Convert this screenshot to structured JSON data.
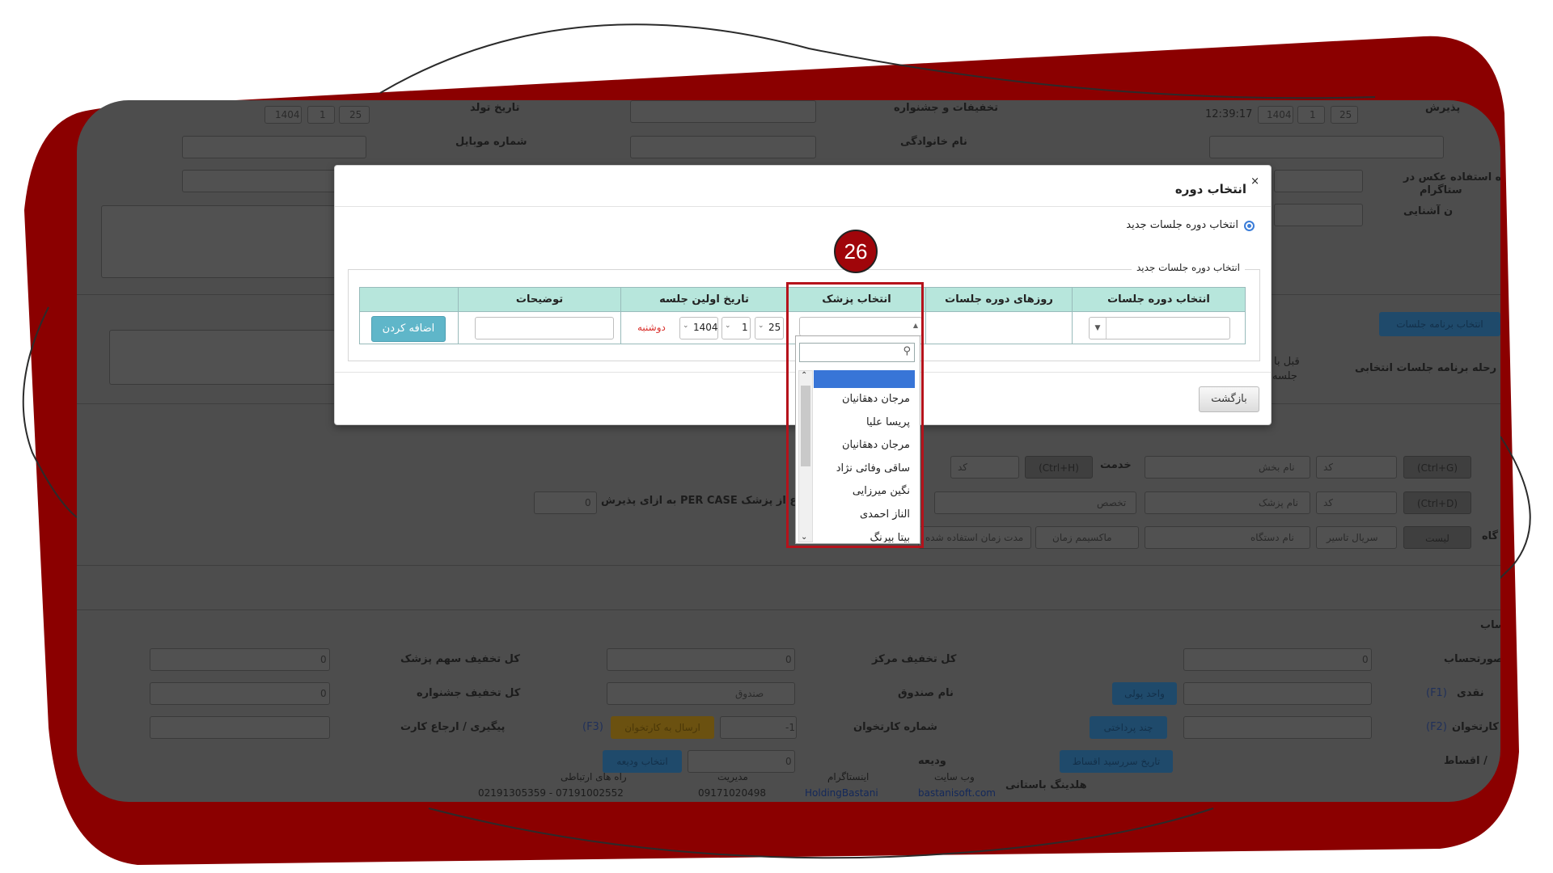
{
  "header": {
    "reception_label": "پذیرش",
    "time": "12:39:17",
    "date_year": "1404",
    "date_month": "1",
    "date_day": "25",
    "birth_date_label": "تاریخ تولد",
    "discounts_label": "تخفیفات و جشنواره",
    "mobile_label": "شماره موبایل",
    "family_label": "نام خانوادگی",
    "photo_usage_label": "ه استفاده عکس در",
    "photo_usage_label2": "ستاگرام",
    "acquaintance_label": "ن آشنایی"
  },
  "middle": {
    "session_program_button": "انتخاب برنامه جلسات",
    "selected_sessions_label": "رحله برنامه جلسات انتخابی",
    "after_label": "قبل با",
    "session_label": "جلسه",
    "service_label": "خدمت",
    "service_placeholder": "نام بخش",
    "code_placeholder": "کد",
    "shortcut_g": "(Ctrl+G)",
    "shortcut_h": "(Ctrl+H)",
    "shortcut_d": "(Ctrl+D)",
    "doctor_placeholder": "نام پزشک",
    "specialty_placeholder": "تخصص",
    "per_case_text": "ع از پزشک PER CASE به ازای پذیرش",
    "per_case_value": "0",
    "device_label": "گاه",
    "device_placeholder": "نام دستگاه",
    "max_time_placeholder": "ماکسیمم زمان",
    "usage_time_placeholder": "مدت زمان استفاده شده",
    "serial_placeholder": "سریال تاسیر",
    "list_button": "لیست"
  },
  "billing": {
    "section_title": "حساب",
    "invoice_label": "صورتحساب",
    "invoice_value": "0",
    "center_discount_label": "کل تخفیف مرکز",
    "center_discount_value": "0",
    "doctor_share_discount_label": "کل تخفیف سهم پزشک",
    "doctor_share_discount_value": "0",
    "cash_label": "نقدی",
    "cash_shortcut": "(F1)",
    "cash_unit_button": "واحد پولی",
    "fund_name_label": "نام صندوق",
    "fund_value": "صندوق",
    "festival_discount_label": "کل تخفیف جشنواره",
    "festival_discount_value": "0",
    "card_label": "کارتخوان",
    "card_shortcut": "(F2)",
    "multi_payment_button": "چند پرداختی",
    "card_number_label": "شماره کارتخوان",
    "card_number_value": "-1",
    "send_to_card_button": "ارسال به کارتخوان",
    "f3_shortcut": "(F3)",
    "tracking_label": "پیگیری / ارجاع کارت",
    "installments_label": "/ اقساط",
    "installment_due_button": "تاریخ سررسید اقساط",
    "deposit_label": "ودیعه",
    "deposit_value": "0",
    "select_deposit_button": "انتخاب ودیعه"
  },
  "footer": {
    "brand": "هلدینگ باستانی",
    "website_label": "وب سایت",
    "website_value": "bastanisoft.com",
    "instagram_label": "اینستاگرام",
    "instagram_value": "HoldingBastani",
    "management_label": "مدیریت",
    "management_value": "09171020498",
    "contact_label": "راه های ارتباطی",
    "contact_value": "07191002552 - 02191305359"
  },
  "modal": {
    "title": "انتخاب دوره",
    "radio_label": "انتخاب دوره جلسات جدید",
    "fieldset_legend": "انتخاب دوره جلسات جدید",
    "columns": [
      "انتخاب دوره جلسات",
      "روزهای دوره جلسات",
      "انتخاب پزشک",
      "تاریخ اولین جلسه",
      "توضیحات",
      ""
    ],
    "first_session_day": "25",
    "first_session_month": "1",
    "first_session_year": "1404",
    "weekday": "دوشنبه",
    "add_button": "اضافه کردن",
    "back_button": "بازگشت"
  },
  "doctor_dropdown": {
    "items": [
      "مرجان دهقانیان",
      "پریسا علیا",
      "مرجان دهقانیان",
      "ساقی وفائی نژاد",
      "نگین میرزایی",
      "الناز احمدی",
      "بیتا بیرنگ"
    ]
  },
  "annotation": {
    "step_number": "26",
    "highlight_color": "#b5121b",
    "frame_color": "#8b0000"
  }
}
